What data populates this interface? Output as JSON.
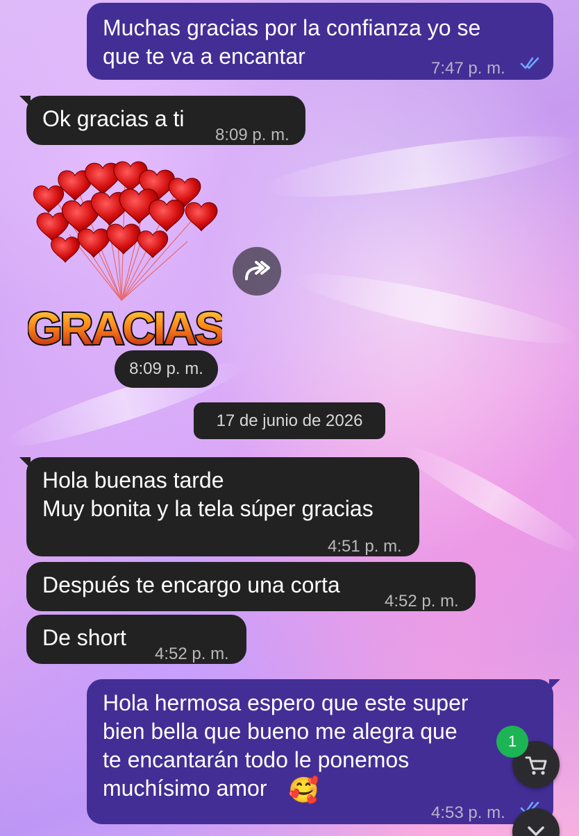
{
  "conversation": {
    "messages": [
      {
        "id": "m1",
        "direction": "outgoing",
        "text": "Muchas gracias  por la confianza  yo se\nque te va a encantar",
        "time": "7:47 p. m.",
        "status": "read"
      },
      {
        "id": "m2",
        "direction": "incoming",
        "text": "Ok gracias a ti",
        "time": "8:09 p. m."
      },
      {
        "id": "m3",
        "direction": "incoming",
        "type": "sticker",
        "sticker_text": "GRACIAS",
        "time": "8:09 p. m."
      },
      {
        "id": "m4",
        "direction": "incoming",
        "text": "Hola buenas tarde\nMuy bonita  y la tela súper gracias",
        "time": "4:51 p. m."
      },
      {
        "id": "m5",
        "direction": "incoming",
        "text": "Después te encargo una corta",
        "time": "4:52 p. m."
      },
      {
        "id": "m6",
        "direction": "incoming",
        "text": "De short",
        "time": "4:52 p. m."
      },
      {
        "id": "m7",
        "direction": "outgoing",
        "text": "Hola hermosa espero que este super\nbien bella que bueno me alegra  que\nte encantarán  todo  le ponemos\nmuchísimo amor",
        "emoji": "🥰",
        "time": "4:53 p. m.",
        "status": "read"
      }
    ],
    "date_separator": "17 de junio de 2026"
  },
  "cart": {
    "badge_count": "1",
    "icon": "cart-icon"
  },
  "icons": {
    "forward": "forward-icon",
    "scroll_down": "chevron-down-icon",
    "read_receipt": "double-check-icon"
  },
  "colors": {
    "outgoing_bubble": "#432e96",
    "incoming_bubble": "#222222",
    "read_ticks": "#6fa8ff",
    "badge": "#1db455"
  }
}
